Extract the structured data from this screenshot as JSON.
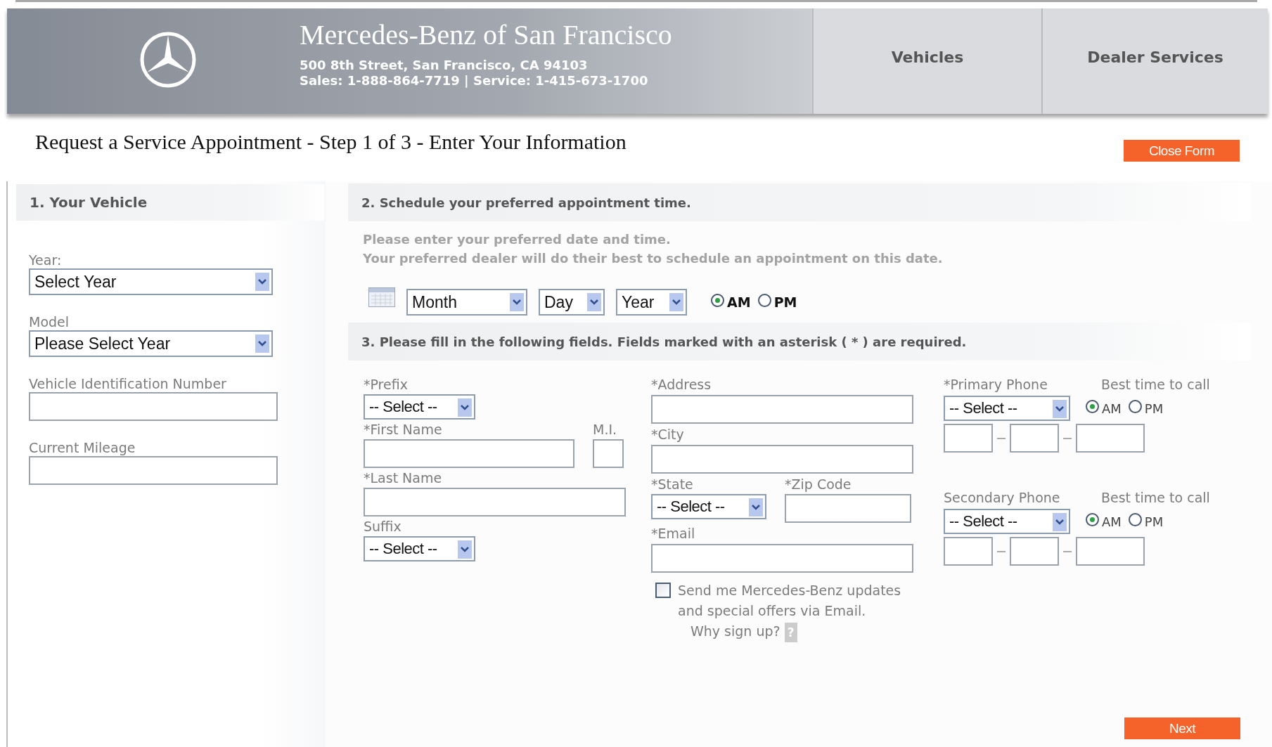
{
  "header": {
    "dealer_name": "Mercedes-Benz of San Francisco",
    "address": "500 8th Street, San Francisco, CA 94103",
    "phones": "Sales: 1-888-864-7719 | Service: 1-415-673-1700",
    "nav": [
      {
        "label": "Vehicles"
      },
      {
        "label": "Dealer Services"
      }
    ]
  },
  "page_title": "Request a Service Appointment - Step 1 of 3 - Enter Your Information",
  "close_button": "Close Form",
  "vehicle": {
    "heading": "1. Your Vehicle",
    "fields": [
      {
        "kind": "select",
        "label": "Year:",
        "value": "Select Year"
      },
      {
        "kind": "select",
        "label": "Model",
        "value": "Please Select Year"
      },
      {
        "kind": "text",
        "label": "Vehicle Identification Number"
      },
      {
        "kind": "text",
        "label": "Current Mileage"
      }
    ]
  },
  "schedule": {
    "heading": "2. Schedule your preferred appointment time.",
    "instructions": [
      "Please enter your preferred date and time.",
      "Your preferred dealer will do their best to schedule an appointment on this date."
    ],
    "date_selects": [
      {
        "value": "Month"
      },
      {
        "value": "Day"
      },
      {
        "value": "Year"
      }
    ],
    "time_options": [
      {
        "label": "AM",
        "selected": true
      },
      {
        "label": "PM",
        "selected": false
      }
    ]
  },
  "details": {
    "heading": "3. Please fill in the following fields. Fields marked with an asterisk ( * ) are required.",
    "prefix": {
      "label": "*Prefix",
      "value": "-- Select --"
    },
    "first_name": {
      "label": "*First Name"
    },
    "middle_initial": {
      "label": "M.I."
    },
    "last_name": {
      "label": "*Last Name"
    },
    "suffix": {
      "label": "Suffix",
      "value": "-- Select --"
    },
    "address": {
      "label": "*Address"
    },
    "city": {
      "label": "*City"
    },
    "state": {
      "label": "*State",
      "value": "-- Select --"
    },
    "zip": {
      "label": "*Zip Code"
    },
    "email": {
      "label": "*Email"
    },
    "newsletter": {
      "checked": false,
      "text": "Send me Mercedes-Benz updates and special offers via Email.",
      "link": "Why sign up?",
      "help": "?"
    },
    "phones": [
      {
        "label": "*Primary Phone",
        "value": "-- Select --",
        "best_time_label": "Best time to call",
        "options": [
          {
            "label": "AM",
            "selected": true
          },
          {
            "label": "PM",
            "selected": false
          }
        ]
      },
      {
        "label": "Secondary Phone",
        "value": "-- Select --",
        "best_time_label": "Best time to call",
        "options": [
          {
            "label": "AM",
            "selected": true
          },
          {
            "label": "PM",
            "selected": false
          }
        ]
      }
    ]
  },
  "next_button": "Next"
}
